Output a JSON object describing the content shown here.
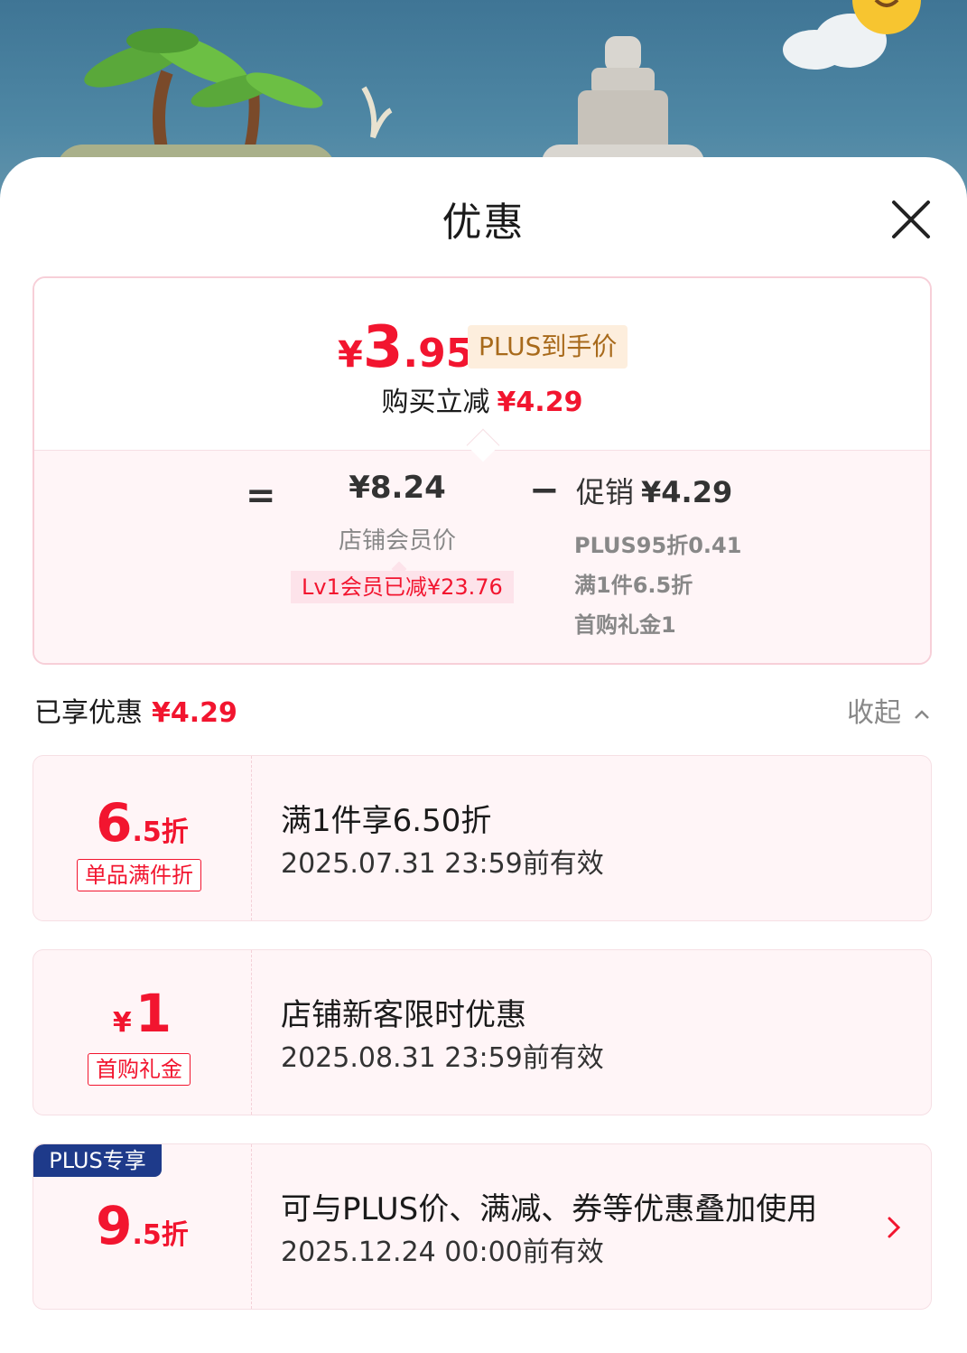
{
  "sheet": {
    "title": "优惠"
  },
  "summary": {
    "final_price": {
      "yen": "¥",
      "int": "3",
      "dec": ".95"
    },
    "plus_tag": "PLUS到手价",
    "instant_label": "购买立减",
    "instant_amount": "¥4.29",
    "equal": "=",
    "member_price": "¥8.24",
    "member_label": "店铺会员价",
    "lv_tag": "Lv1会员已减¥23.76",
    "minus": "−",
    "promo_label": "促销",
    "promo_amount": "¥4.29",
    "promo_items": [
      "PLUS95折0.41",
      "满1件6.5折",
      "首购礼金1"
    ]
  },
  "enjoyed": {
    "label": "已享优惠",
    "amount": "¥4.29",
    "collapse_label": "收起"
  },
  "coupons": [
    {
      "value_big": "6",
      "value_small": ".5折",
      "type": "单品满件折",
      "title": "满1件享6.50折",
      "date": "2025.07.31 23:59前有效"
    },
    {
      "value_yen": "¥",
      "value_big": "1",
      "type": "首购礼金",
      "title": "店铺新客限时优惠",
      "date": "2025.08.31 23:59前有效"
    },
    {
      "badge": "PLUS专享",
      "value_big": "9",
      "value_small": ".5折",
      "title": "可与PLUS价、满减、券等优惠叠加使用",
      "date": "2025.12.24 00:00前有效"
    }
  ],
  "colors": {
    "accent_red": "#f2152f",
    "plus_blue": "#1e3a8a",
    "plus_gold_bg": "#fdeedd",
    "plus_gold_text": "#a86a1b"
  },
  "icons": [
    "close-icon",
    "chevron-up-icon",
    "chevron-right-icon"
  ]
}
